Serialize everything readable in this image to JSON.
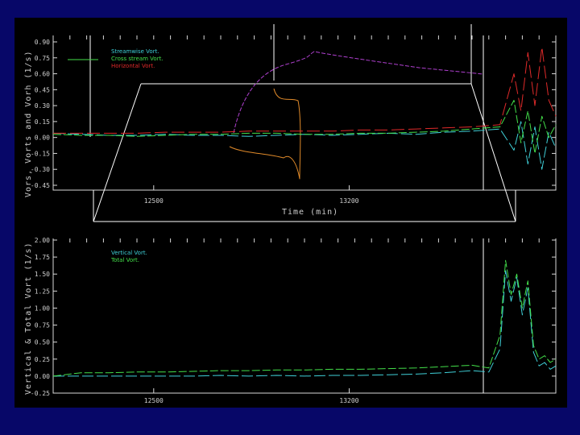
{
  "colors": {
    "background": "#070768",
    "panel": "#000000",
    "streamwise": "#3fd0d8",
    "cross_stream": "#43e04a",
    "horizontal": "#e02a2a",
    "vertical": "#3fd0d8",
    "total": "#43e04a",
    "magenta": "#b040d0",
    "orange": "#e08a2a"
  },
  "chart_data": [
    {
      "type": "line",
      "ylabel": "Vors, Vorts and Vorh (1/s)",
      "xlabel": "Time (min)",
      "yticks": [
        "0.90",
        "0.75",
        "0.60",
        "0.45",
        "0.30",
        "0.15",
        "0.00",
        "-0.15",
        "-0.30",
        "-0.45"
      ],
      "ylim": [
        -0.45,
        0.9
      ],
      "xticks": [
        "12500",
        "13200"
      ],
      "xlim": [
        12140,
        13940
      ],
      "legend": [
        "Streamwise Vort.",
        "Cross stream Vort.",
        "Horizontal Vort."
      ],
      "legend_position": "top-left",
      "series": [
        {
          "name": "Streamwise Vort.",
          "color_key": "streamwise",
          "x": [
            12140,
            12240,
            12340,
            12440,
            12540,
            12640,
            12740,
            12840,
            12940,
            13040,
            13140,
            13240,
            13340,
            13440,
            13540,
            13640,
            13740,
            13790,
            13815,
            13840,
            13865,
            13890,
            13915,
            13940
          ],
          "y": [
            0.04,
            0.03,
            0.02,
            0.02,
            0.03,
            0.02,
            0.02,
            0.01,
            0.02,
            0.03,
            0.02,
            0.03,
            0.04,
            0.03,
            0.05,
            0.06,
            0.08,
            -0.12,
            0.15,
            -0.25,
            0.1,
            -0.3,
            0.05,
            -0.1
          ]
        },
        {
          "name": "Cross stream Vort.",
          "color_key": "cross_stream",
          "x": [
            12140,
            12240,
            12340,
            12440,
            12540,
            12640,
            12740,
            12840,
            12940,
            13040,
            13140,
            13240,
            13340,
            13440,
            13540,
            13640,
            13740,
            13790,
            13815,
            13840,
            13865,
            13890,
            13915,
            13940
          ],
          "y": [
            0.03,
            0.02,
            0.02,
            0.01,
            0.02,
            0.03,
            0.03,
            0.04,
            0.04,
            0.03,
            0.03,
            0.04,
            0.04,
            0.05,
            0.06,
            0.08,
            0.1,
            0.35,
            -0.05,
            0.25,
            -0.15,
            0.2,
            0.0,
            0.12
          ]
        },
        {
          "name": "Horizontal Vort.",
          "color_key": "horizontal",
          "x": [
            12140,
            12240,
            12340,
            12440,
            12540,
            12640,
            12740,
            12840,
            12940,
            13040,
            13140,
            13240,
            13340,
            13440,
            13540,
            13640,
            13740,
            13790,
            13815,
            13840,
            13865,
            13890,
            13915,
            13940
          ],
          "y": [
            0.04,
            0.04,
            0.04,
            0.04,
            0.05,
            0.05,
            0.05,
            0.06,
            0.06,
            0.06,
            0.06,
            0.07,
            0.07,
            0.08,
            0.09,
            0.1,
            0.12,
            0.6,
            0.25,
            0.8,
            0.3,
            0.85,
            0.35,
            0.2
          ]
        }
      ]
    },
    {
      "type": "line",
      "ylabel": "Vertical & Total Vort (1/s)",
      "yticks": [
        "2.00",
        "1.75",
        "1.50",
        "1.25",
        "1.00",
        "0.75",
        "0.50",
        "0.25",
        "0.00",
        "-0.25"
      ],
      "ylim": [
        -0.25,
        2.0
      ],
      "xticks": [
        "12500",
        "13200"
      ],
      "xlim": [
        12140,
        13940
      ],
      "legend": [
        "Vertical Vort.",
        "Total Vort."
      ],
      "legend_position": "top-left",
      "series": [
        {
          "name": "Vertical Vort.",
          "color_key": "vertical",
          "x": [
            12140,
            12240,
            12340,
            12440,
            12540,
            12640,
            12740,
            12840,
            12940,
            13040,
            13140,
            13240,
            13340,
            13440,
            13540,
            13640,
            13700,
            13740,
            13760,
            13780,
            13800,
            13820,
            13840,
            13860,
            13880,
            13900,
            13920,
            13940
          ],
          "y": [
            0.0,
            0.0,
            0.0,
            0.0,
            0.0,
            0.0,
            0.01,
            0.0,
            0.01,
            0.0,
            0.01,
            0.01,
            0.02,
            0.03,
            0.05,
            0.08,
            0.06,
            0.4,
            1.55,
            1.1,
            1.45,
            0.9,
            1.3,
            0.35,
            0.15,
            0.2,
            0.1,
            0.15
          ]
        },
        {
          "name": "Total Vort.",
          "color_key": "total",
          "x": [
            12140,
            12240,
            12340,
            12440,
            12540,
            12640,
            12740,
            12840,
            12940,
            13040,
            13140,
            13240,
            13340,
            13440,
            13540,
            13640,
            13700,
            13740,
            13760,
            13780,
            13800,
            13820,
            13840,
            13860,
            13880,
            13900,
            13920,
            13940
          ],
          "y": [
            0.0,
            0.05,
            0.05,
            0.06,
            0.06,
            0.07,
            0.08,
            0.08,
            0.09,
            0.09,
            0.1,
            0.1,
            0.11,
            0.12,
            0.14,
            0.16,
            0.12,
            0.6,
            1.7,
            1.2,
            1.5,
            1.0,
            1.4,
            0.45,
            0.25,
            0.3,
            0.2,
            0.25
          ]
        }
      ]
    }
  ]
}
